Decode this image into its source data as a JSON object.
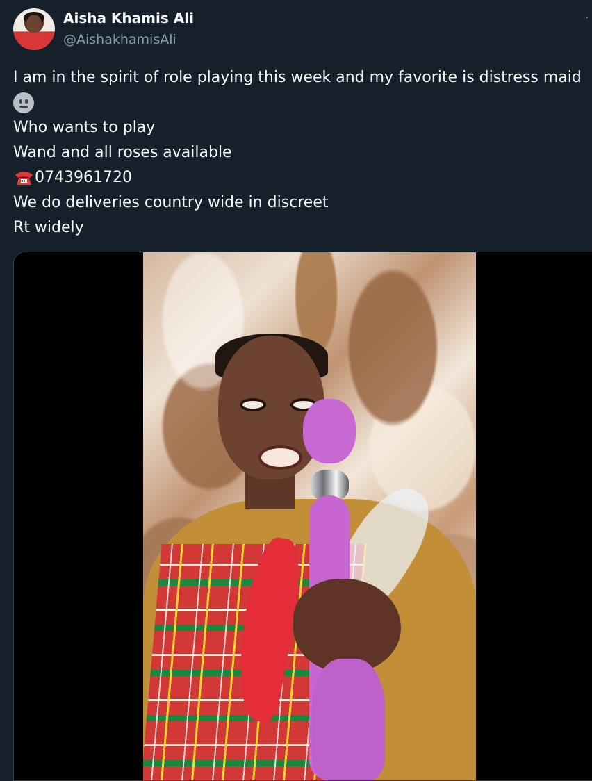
{
  "author": {
    "display_name": "Aisha Khamis Ali",
    "handle": "@AishakhamisAli"
  },
  "tweet": {
    "lines": [
      "I am in the spirit of role playing this week and my favorite is distress maid",
      "",
      "Who wants to play",
      "Wand and all roses available",
      "0743961720",
      "We do deliveries country wide in discreet",
      "Rt widely"
    ]
  },
  "menu": {
    "more_icon": "more-icon"
  },
  "media": {
    "type": "video",
    "icon": "video-player"
  },
  "colors": {
    "background": "#15202b",
    "primary_text": "#f7f9f9",
    "secondary_text": "#8b98a5",
    "border": "#38444d",
    "media_background": "#000000"
  }
}
